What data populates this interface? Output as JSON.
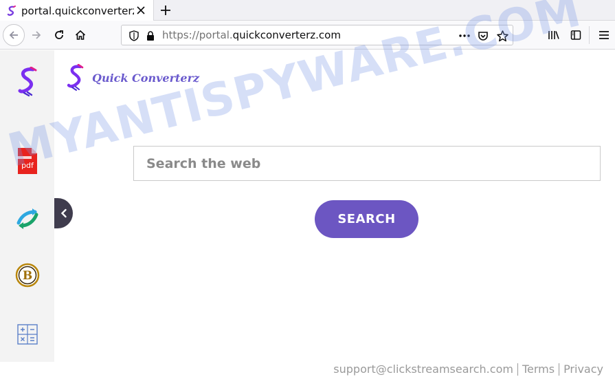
{
  "tab": {
    "title": "portal.quickconverterz"
  },
  "url": {
    "prefix": "https://portal.",
    "domain": "quickconverterz.com"
  },
  "logo": {
    "text": "Quick Converterz"
  },
  "search": {
    "placeholder": "Search the web",
    "button_label": "SEARCH"
  },
  "watermark": {
    "text": "MYANTISPYWARE.COM"
  },
  "footer": {
    "email": "support@clickstreamsearch.com",
    "terms": "Terms",
    "privacy": "Privacy"
  },
  "sidebar": {
    "items": [
      {
        "icon": "quickconverterz-logo-icon"
      },
      {
        "icon": "pdf-icon",
        "label": "pdf"
      },
      {
        "icon": "convert-arrows-icon"
      },
      {
        "icon": "bitcoin-icon",
        "label": "B"
      },
      {
        "icon": "calculator-icon"
      }
    ]
  },
  "colors": {
    "brand": "#6c56c2",
    "logo_text": "#6a5acd",
    "pdf": "#e8231e",
    "watermark": "#7896e6"
  }
}
